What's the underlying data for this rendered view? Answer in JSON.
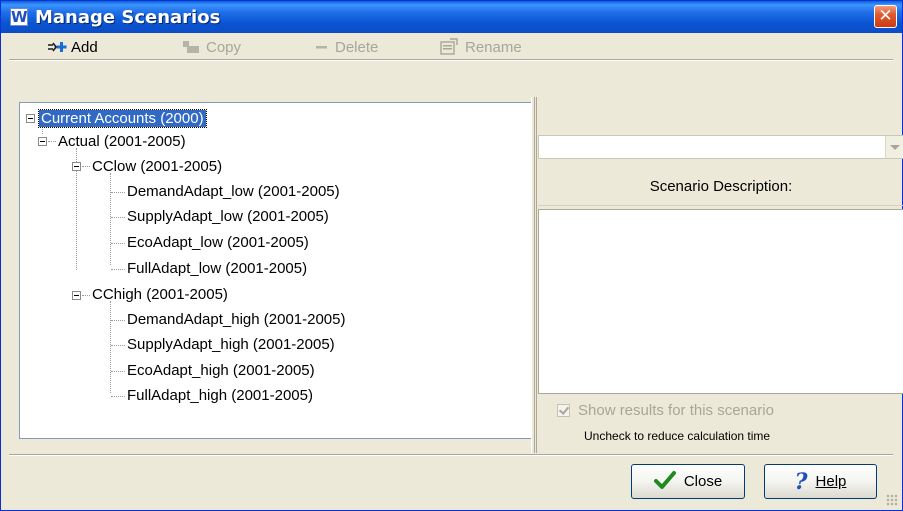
{
  "window": {
    "title": "Manage Scenarios",
    "app_icon_letter": "W",
    "close_glyph": "✕"
  },
  "toolbar": {
    "add": {
      "label": "Add",
      "enabled": true
    },
    "copy": {
      "label": "Copy",
      "enabled": false
    },
    "delete": {
      "label": "Delete",
      "enabled": false
    },
    "rename": {
      "label": "Rename",
      "enabled": false
    }
  },
  "tree": {
    "root": "Current Accounts (2000)",
    "actual": "Actual (2001-2005)",
    "cclow": "CClow (2001-2005)",
    "cclow_children": [
      "DemandAdapt_low (2001-2005)",
      "SupplyAdapt_low (2001-2005)",
      "EcoAdapt_low (2001-2005)",
      "FullAdapt_low (2001-2005)"
    ],
    "cchigh": "CChigh (2001-2005)",
    "cchigh_children": [
      "DemandAdapt_high (2001-2005)",
      "SupplyAdapt_high (2001-2005)",
      "EcoAdapt_high (2001-2005)",
      "FullAdapt_high (2001-2005)"
    ]
  },
  "details": {
    "scenario_select_value": "",
    "description_header": "Scenario Description:",
    "description_text": "",
    "show_results_label": "Show results for this scenario",
    "show_results_checked": true,
    "hint": "Uncheck to reduce calculation time"
  },
  "buttons": {
    "close": "Close",
    "help": "Help"
  },
  "colors": {
    "title_blue": "#0a54d3",
    "selection": "#316ac5",
    "close_red": "#e35a2f",
    "face": "#ece9d8"
  }
}
